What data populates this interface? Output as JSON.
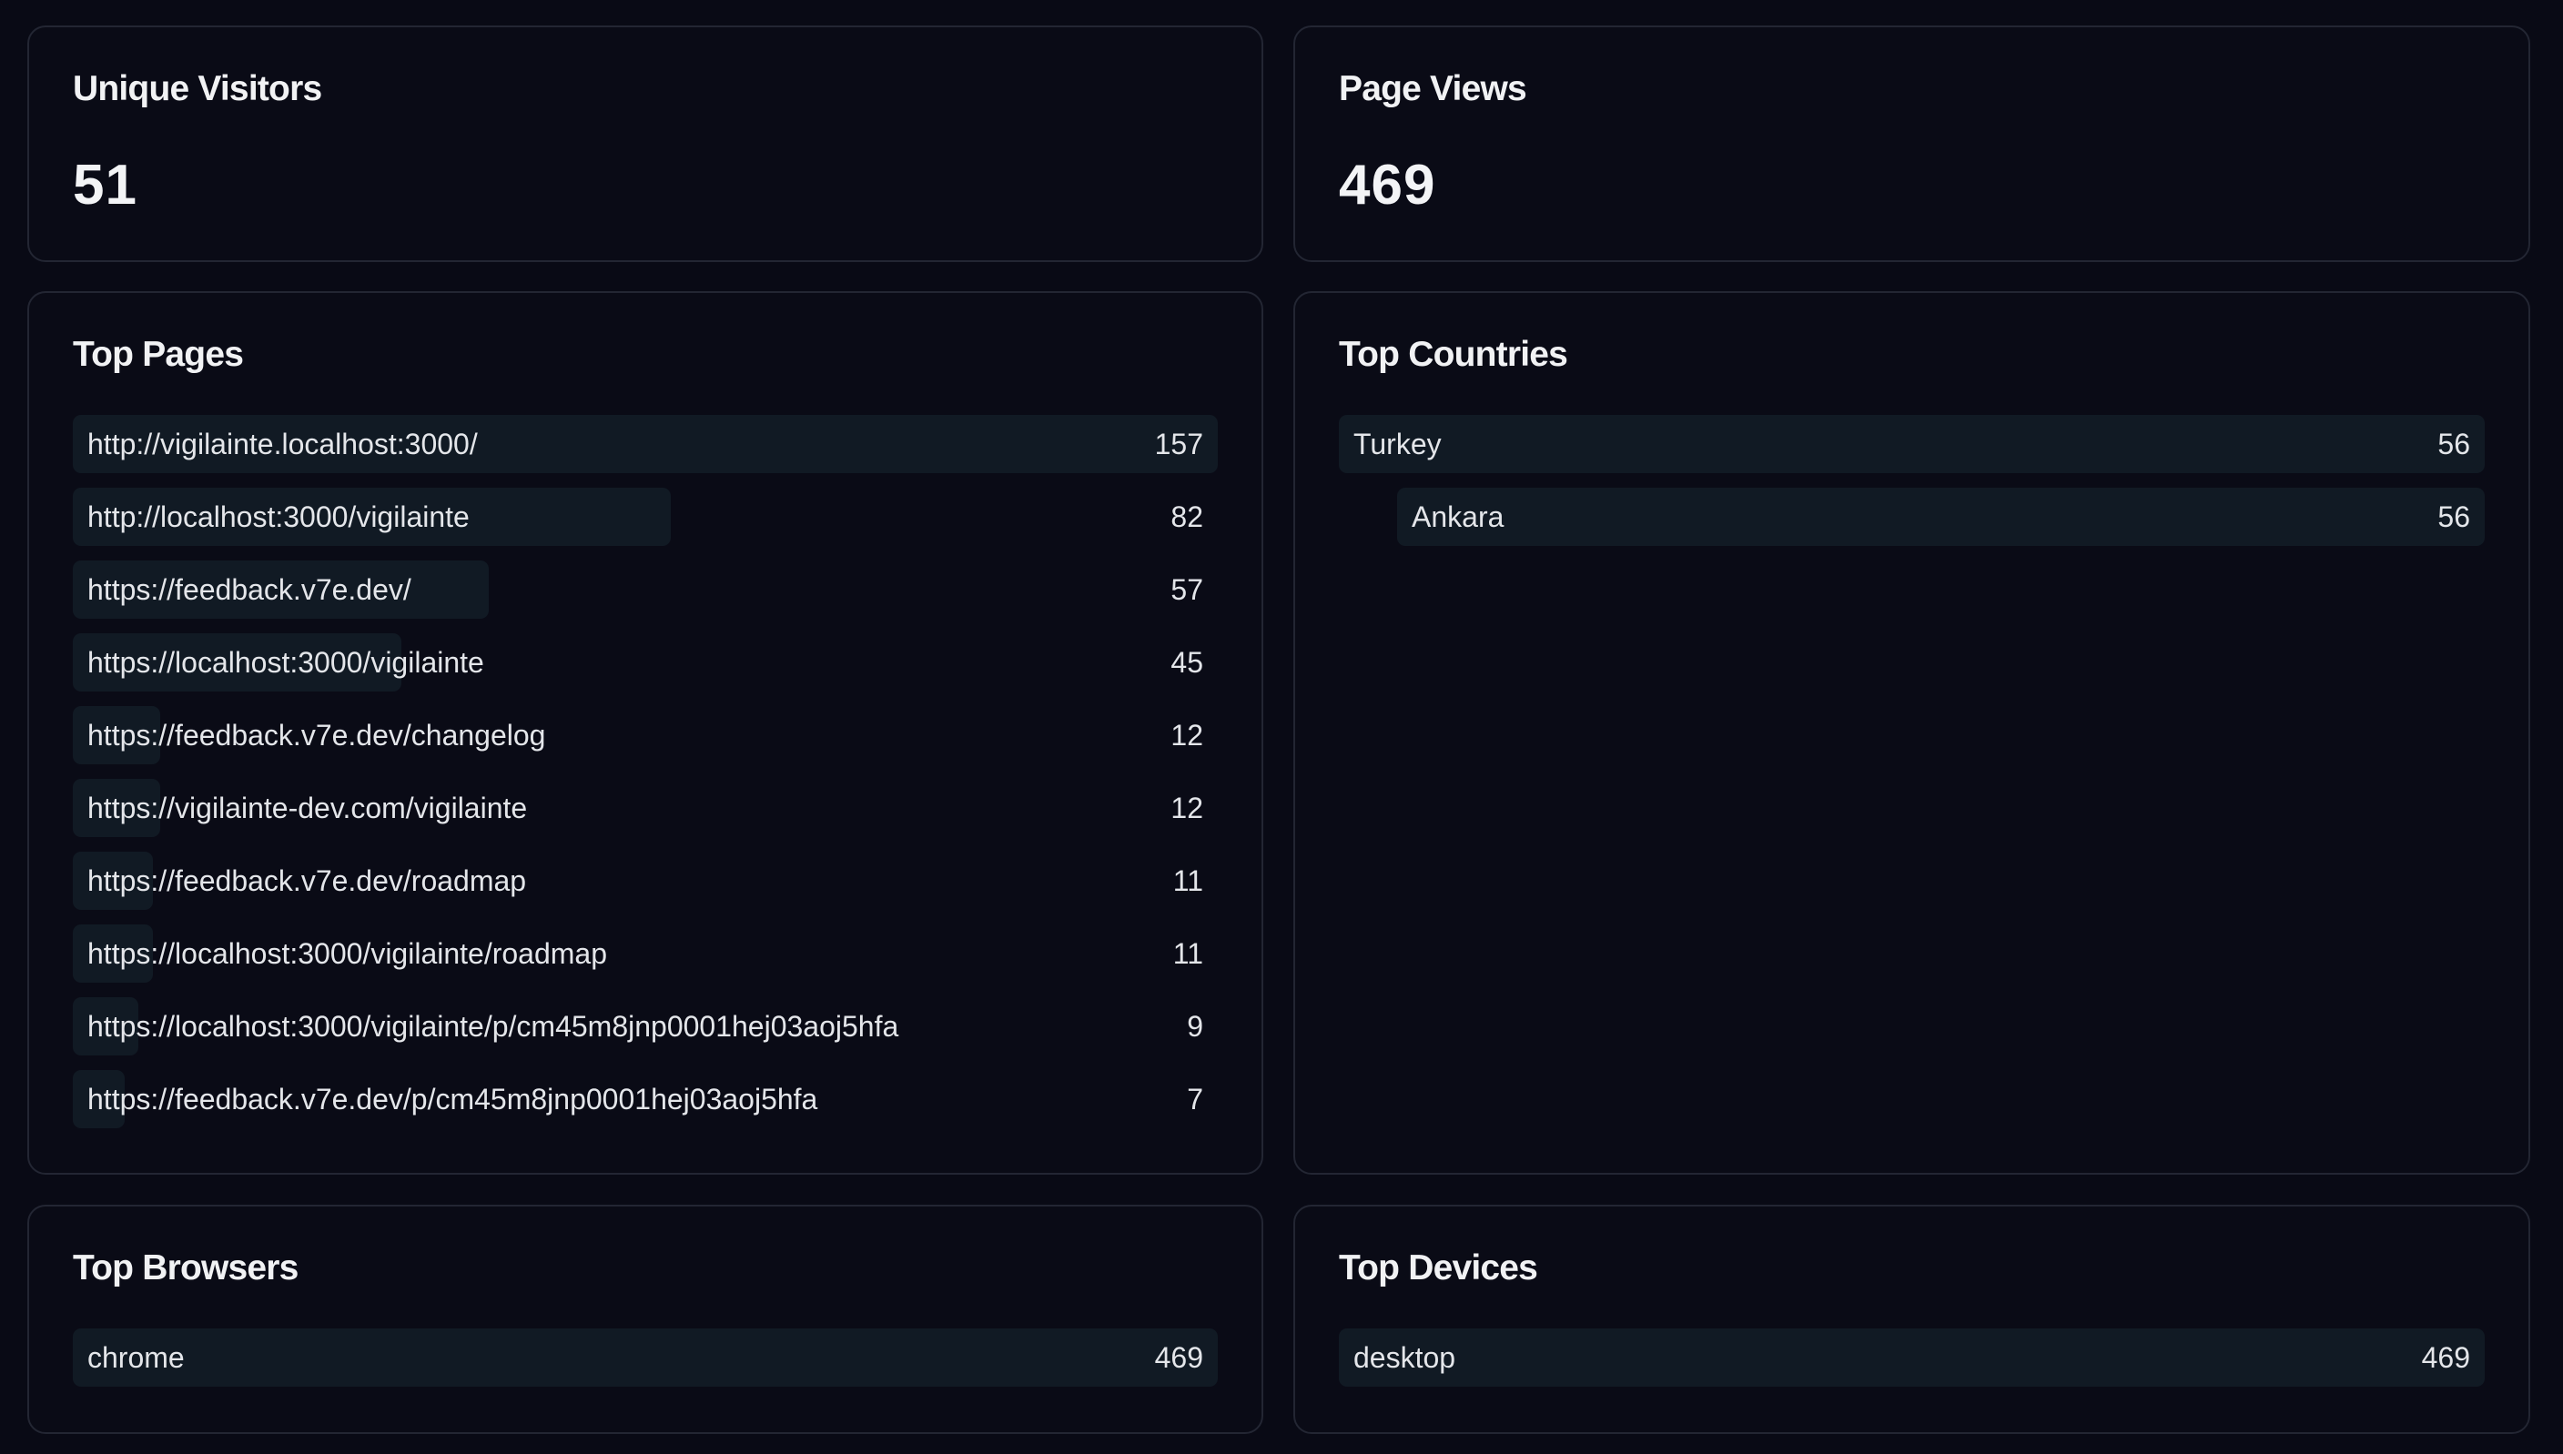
{
  "stats": {
    "unique_visitors": {
      "title": "Unique Visitors",
      "value": "51"
    },
    "page_views": {
      "title": "Page Views",
      "value": "469"
    }
  },
  "top_pages": {
    "title": "Top Pages",
    "items": [
      {
        "label": "http://vigilainte.localhost:3000/",
        "value": "157",
        "fraction": 1.0
      },
      {
        "label": "http://localhost:3000/vigilainte",
        "value": "82",
        "fraction": 0.522
      },
      {
        "label": "https://feedback.v7e.dev/",
        "value": "57",
        "fraction": 0.363
      },
      {
        "label": "https://localhost:3000/vigilainte",
        "value": "45",
        "fraction": 0.287
      },
      {
        "label": "https://feedback.v7e.dev/changelog",
        "value": "12",
        "fraction": 0.076
      },
      {
        "label": "https://vigilainte-dev.com/vigilainte",
        "value": "12",
        "fraction": 0.076
      },
      {
        "label": "https://feedback.v7e.dev/roadmap",
        "value": "11",
        "fraction": 0.07
      },
      {
        "label": "https://localhost:3000/vigilainte/roadmap",
        "value": "11",
        "fraction": 0.07
      },
      {
        "label": "https://localhost:3000/vigilainte/p/cm45m8jnp0001hej03aoj5hfa",
        "value": "9",
        "fraction": 0.057
      },
      {
        "label": "https://feedback.v7e.dev/p/cm45m8jnp0001hej03aoj5hfa",
        "value": "7",
        "fraction": 0.045
      }
    ]
  },
  "top_countries": {
    "title": "Top Countries",
    "items": [
      {
        "label": "Turkey",
        "value": "56",
        "fraction": 1.0
      },
      {
        "label": "Ankara",
        "value": "56",
        "fraction": 1.0,
        "sub": true
      }
    ]
  },
  "top_browsers": {
    "title": "Top Browsers",
    "items": [
      {
        "label": "chrome",
        "value": "469",
        "fraction": 1.0
      }
    ]
  },
  "top_devices": {
    "title": "Top Devices",
    "items": [
      {
        "label": "desktop",
        "value": "469",
        "fraction": 1.0
      }
    ]
  },
  "colors": {
    "background": "#090a15",
    "card_border": "#232633",
    "bar": "#111a24",
    "text": "#e4e6ea"
  }
}
